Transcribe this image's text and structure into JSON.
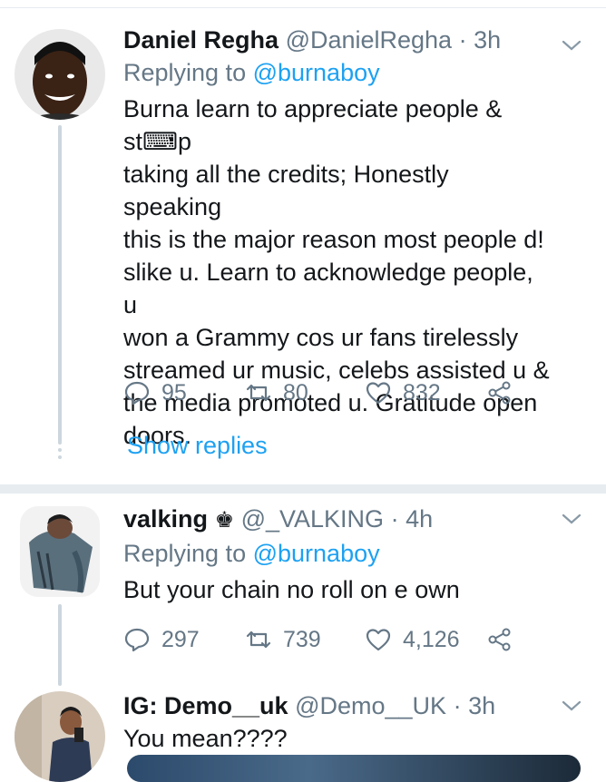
{
  "tweets": [
    {
      "name": "Daniel Regha",
      "handle": "@DanielRegha",
      "dot": "·",
      "time": "3h",
      "replying_prefix": "Replying to",
      "replying_to": "@burnaboy",
      "lines": [
        "Burna learn to appreciate people & st⌨p",
        "taking all the credits; Honestly speaking",
        "this is the major reason most people d!",
        "slike u. Learn to acknowledge people, u",
        "won a Grammy cos ur fans tirelessly",
        "streamed ur music, celebs assisted u &",
        "the media promoted u. Gratitude open",
        "doors."
      ],
      "replies": "95",
      "retweets": "80",
      "likes": "832",
      "show_replies": "Show replies"
    },
    {
      "name": "valking",
      "badge": "♚",
      "handle": "@_VALKING",
      "dot": "·",
      "time": "4h",
      "replying_prefix": "Replying to",
      "replying_to": "@burnaboy",
      "lines": [
        "But your chain no roll on e own"
      ],
      "replies": "297",
      "retweets": "739",
      "likes": "4,126"
    },
    {
      "name": "IG: Demo__uk",
      "handle": "@Demo__UK",
      "dot": "·",
      "time": "3h",
      "lines": [
        "You mean????"
      ]
    }
  ],
  "colors": {
    "accent": "#1da1f2",
    "muted": "#657786",
    "text": "#14171a",
    "divider": "#e6ecf0"
  },
  "icons": {
    "reply": "reply-icon",
    "retweet": "retweet-icon",
    "like": "heart-icon",
    "share": "share-icon",
    "menu": "chevron-down-icon"
  }
}
